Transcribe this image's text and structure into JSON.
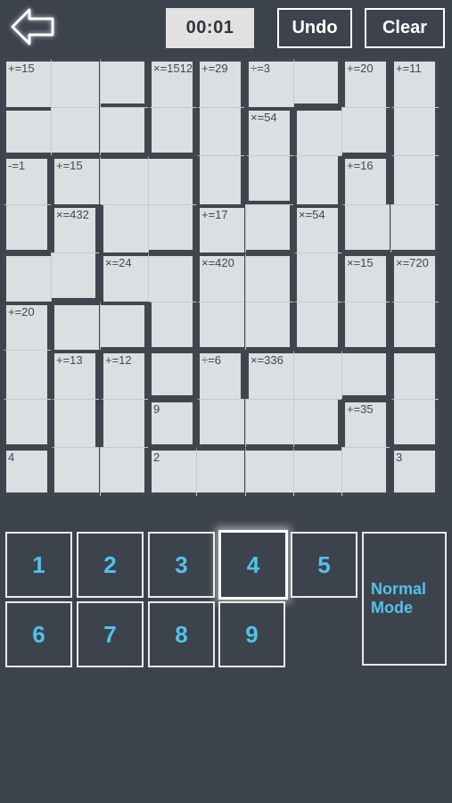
{
  "app": {
    "name": "kenken-puzzle",
    "background_color": "#3d434d",
    "accent_color": "#4fc3ec",
    "cell_color": "#dcdfe1",
    "cage_border_color": "#40454e"
  },
  "topbar": {
    "back_icon": "back-arrow-icon",
    "timer": "00:01",
    "undo_label": "Undo",
    "clear_label": "Clear"
  },
  "grid": {
    "size": 9,
    "cells": [
      {
        "r": 0,
        "c": 0,
        "label": "+=15",
        "value": "",
        "t": 1,
        "l": 1,
        "b": 0,
        "r_": 0
      },
      {
        "r": 0,
        "c": 1,
        "label": "",
        "value": "",
        "t": 1,
        "l": 0,
        "b": 0,
        "r_": 0
      },
      {
        "r": 0,
        "c": 2,
        "label": "",
        "value": "",
        "t": 1,
        "l": 0,
        "b": 1,
        "r_": 1
      },
      {
        "r": 0,
        "c": 3,
        "label": "×=1512",
        "value": "",
        "t": 1,
        "l": 1,
        "b": 0,
        "r_": 1
      },
      {
        "r": 0,
        "c": 4,
        "label": "+=29",
        "value": "",
        "t": 1,
        "l": 1,
        "b": 0,
        "r_": 1
      },
      {
        "r": 0,
        "c": 5,
        "label": "÷=3",
        "value": "",
        "t": 1,
        "l": 1,
        "b": 0,
        "r_": 0
      },
      {
        "r": 0,
        "c": 6,
        "label": "",
        "value": "",
        "t": 1,
        "l": 0,
        "b": 1,
        "r_": 1
      },
      {
        "r": 0,
        "c": 7,
        "label": "+=20",
        "value": "",
        "t": 1,
        "l": 1,
        "b": 0,
        "r_": 1
      },
      {
        "r": 0,
        "c": 8,
        "label": "+=11",
        "value": "",
        "t": 1,
        "l": 1,
        "b": 0,
        "r_": 1
      },
      {
        "r": 1,
        "c": 0,
        "label": "",
        "value": "",
        "t": 1,
        "l": 1,
        "b": 1,
        "r_": 0
      },
      {
        "r": 1,
        "c": 1,
        "label": "",
        "value": "",
        "t": 0,
        "l": 0,
        "b": 1,
        "r_": 0
      },
      {
        "r": 1,
        "c": 2,
        "label": "",
        "value": "",
        "t": 0,
        "l": 0,
        "b": 1,
        "r_": 1
      },
      {
        "r": 1,
        "c": 3,
        "label": "",
        "value": "",
        "t": 0,
        "l": 1,
        "b": 1,
        "r_": 1
      },
      {
        "r": 1,
        "c": 4,
        "label": "",
        "value": "",
        "t": 0,
        "l": 1,
        "b": 0,
        "r_": 1
      },
      {
        "r": 1,
        "c": 5,
        "label": "×=54",
        "value": "",
        "t": 1,
        "l": 1,
        "b": 0,
        "r_": 1
      },
      {
        "r": 1,
        "c": 6,
        "label": "",
        "value": "",
        "t": 1,
        "l": 1,
        "b": 0,
        "r_": 0
      },
      {
        "r": 1,
        "c": 7,
        "label": "",
        "value": "",
        "t": 0,
        "l": 0,
        "b": 1,
        "r_": 1
      },
      {
        "r": 1,
        "c": 8,
        "label": "",
        "value": "",
        "t": 0,
        "l": 1,
        "b": 0,
        "r_": 1
      },
      {
        "r": 2,
        "c": 0,
        "label": "-=1",
        "value": "",
        "t": 1,
        "l": 1,
        "b": 0,
        "r_": 1
      },
      {
        "r": 2,
        "c": 1,
        "label": "+=15",
        "value": "",
        "t": 1,
        "l": 1,
        "b": 0,
        "r_": 0
      },
      {
        "r": 2,
        "c": 2,
        "label": "",
        "value": "",
        "t": 1,
        "l": 0,
        "b": 0,
        "r_": 0
      },
      {
        "r": 2,
        "c": 3,
        "label": "",
        "value": "",
        "t": 1,
        "l": 0,
        "b": 0,
        "r_": 1
      },
      {
        "r": 2,
        "c": 4,
        "label": "",
        "value": "",
        "t": 0,
        "l": 1,
        "b": 0,
        "r_": 1
      },
      {
        "r": 2,
        "c": 5,
        "label": "",
        "value": "",
        "t": 0,
        "l": 1,
        "b": 1,
        "r_": 1
      },
      {
        "r": 2,
        "c": 6,
        "label": "",
        "value": "",
        "t": 0,
        "l": 1,
        "b": 0,
        "r_": 1
      },
      {
        "r": 2,
        "c": 7,
        "label": "+=16",
        "value": "",
        "t": 1,
        "l": 1,
        "b": 0,
        "r_": 1
      },
      {
        "r": 2,
        "c": 8,
        "label": "",
        "value": "",
        "t": 0,
        "l": 1,
        "b": 0,
        "r_": 1
      },
      {
        "r": 3,
        "c": 0,
        "label": "",
        "value": "",
        "t": 0,
        "l": 1,
        "b": 1,
        "r_": 1
      },
      {
        "r": 3,
        "c": 1,
        "label": "×=432",
        "value": "",
        "t": 1,
        "l": 1,
        "b": 0,
        "r_": 1
      },
      {
        "r": 3,
        "c": 2,
        "label": "",
        "value": "",
        "t": 0,
        "l": 1,
        "b": 0,
        "r_": 0
      },
      {
        "r": 3,
        "c": 3,
        "label": "",
        "value": "",
        "t": 0,
        "l": 0,
        "b": 1,
        "r_": 1
      },
      {
        "r": 3,
        "c": 4,
        "label": "+=17",
        "value": "",
        "t": 1,
        "l": 1,
        "b": 0,
        "r_": 0
      },
      {
        "r": 3,
        "c": 5,
        "label": "",
        "value": "",
        "t": 0,
        "l": 0,
        "b": 1,
        "r_": 1
      },
      {
        "r": 3,
        "c": 6,
        "label": "×=54",
        "value": "",
        "t": 1,
        "l": 1,
        "b": 0,
        "r_": 1
      },
      {
        "r": 3,
        "c": 7,
        "label": "",
        "value": "",
        "t": 0,
        "l": 1,
        "b": 1,
        "r_": 0
      },
      {
        "r": 3,
        "c": 8,
        "label": "",
        "value": "",
        "t": 0,
        "l": 0,
        "b": 1,
        "r_": 1
      },
      {
        "r": 4,
        "c": 0,
        "label": "",
        "value": "",
        "t": 1,
        "l": 1,
        "b": 0,
        "r_": 0
      },
      {
        "r": 4,
        "c": 1,
        "label": "",
        "value": "",
        "t": 0,
        "l": 0,
        "b": 1,
        "r_": 1
      },
      {
        "r": 4,
        "c": 2,
        "label": "×=24",
        "value": "",
        "t": 1,
        "l": 1,
        "b": 0,
        "r_": 0
      },
      {
        "r": 4,
        "c": 3,
        "label": "",
        "value": "",
        "t": 1,
        "l": 0,
        "b": 0,
        "r_": 1
      },
      {
        "r": 4,
        "c": 4,
        "label": "×=420",
        "value": "",
        "t": 1,
        "l": 1,
        "b": 0,
        "r_": 0
      },
      {
        "r": 4,
        "c": 5,
        "label": "",
        "value": "",
        "t": 1,
        "l": 0,
        "b": 0,
        "r_": 1
      },
      {
        "r": 4,
        "c": 6,
        "label": "",
        "value": "",
        "t": 0,
        "l": 1,
        "b": 0,
        "r_": 1
      },
      {
        "r": 4,
        "c": 7,
        "label": "×=15",
        "value": "",
        "t": 1,
        "l": 1,
        "b": 0,
        "r_": 1
      },
      {
        "r": 4,
        "c": 8,
        "label": "×=720",
        "value": "",
        "t": 1,
        "l": 1,
        "b": 0,
        "r_": 1
      },
      {
        "r": 5,
        "c": 0,
        "label": "+=20",
        "value": "",
        "t": 1,
        "l": 1,
        "b": 0,
        "r_": 1
      },
      {
        "r": 5,
        "c": 1,
        "label": "",
        "value": "",
        "t": 1,
        "l": 1,
        "b": 0,
        "r_": 0
      },
      {
        "r": 5,
        "c": 2,
        "label": "",
        "value": "",
        "t": 1,
        "l": 0,
        "b": 1,
        "r_": 1
      },
      {
        "r": 5,
        "c": 3,
        "label": "",
        "value": "",
        "t": 0,
        "l": 1,
        "b": 1,
        "r_": 1
      },
      {
        "r": 5,
        "c": 4,
        "label": "",
        "value": "",
        "t": 0,
        "l": 1,
        "b": 1,
        "r_": 0
      },
      {
        "r": 5,
        "c": 5,
        "label": "",
        "value": "",
        "t": 0,
        "l": 0,
        "b": 1,
        "r_": 1
      },
      {
        "r": 5,
        "c": 6,
        "label": "",
        "value": "",
        "t": 0,
        "l": 1,
        "b": 1,
        "r_": 1
      },
      {
        "r": 5,
        "c": 7,
        "label": "",
        "value": "",
        "t": 0,
        "l": 1,
        "b": 1,
        "r_": 1
      },
      {
        "r": 5,
        "c": 8,
        "label": "",
        "value": "",
        "t": 0,
        "l": 1,
        "b": 1,
        "r_": 1
      },
      {
        "r": 6,
        "c": 0,
        "label": "",
        "value": "",
        "t": 0,
        "l": 1,
        "b": 0,
        "r_": 1
      },
      {
        "r": 6,
        "c": 1,
        "label": "+=13",
        "value": "",
        "t": 1,
        "l": 1,
        "b": 0,
        "r_": 1
      },
      {
        "r": 6,
        "c": 2,
        "label": "+=12",
        "value": "",
        "t": 1,
        "l": 1,
        "b": 0,
        "r_": 1
      },
      {
        "r": 6,
        "c": 3,
        "label": "",
        "value": "",
        "t": 1,
        "l": 1,
        "b": 1,
        "r_": 1
      },
      {
        "r": 6,
        "c": 4,
        "label": "÷=6",
        "value": "",
        "t": 1,
        "l": 1,
        "b": 0,
        "r_": 1
      },
      {
        "r": 6,
        "c": 5,
        "label": "×=336",
        "value": "",
        "t": 1,
        "l": 1,
        "b": 0,
        "r_": 0
      },
      {
        "r": 6,
        "c": 6,
        "label": "",
        "value": "",
        "t": 1,
        "l": 0,
        "b": 0,
        "r_": 0
      },
      {
        "r": 6,
        "c": 7,
        "label": "",
        "value": "",
        "t": 1,
        "l": 0,
        "b": 1,
        "r_": 1
      },
      {
        "r": 6,
        "c": 8,
        "label": "",
        "value": "",
        "t": 1,
        "l": 1,
        "b": 0,
        "r_": 1
      },
      {
        "r": 7,
        "c": 0,
        "label": "",
        "value": "",
        "t": 0,
        "l": 1,
        "b": 1,
        "r_": 1
      },
      {
        "r": 7,
        "c": 1,
        "label": "",
        "value": "",
        "t": 0,
        "l": 1,
        "b": 0,
        "r_": 1
      },
      {
        "r": 7,
        "c": 2,
        "label": "",
        "value": "",
        "t": 0,
        "l": 1,
        "b": 0,
        "r_": 1
      },
      {
        "r": 7,
        "c": 3,
        "label": "9",
        "value": "",
        "t": 1,
        "l": 1,
        "b": 1,
        "r_": 1
      },
      {
        "r": 7,
        "c": 4,
        "label": "",
        "value": "",
        "t": 0,
        "l": 1,
        "b": 1,
        "r_": 0
      },
      {
        "r": 7,
        "c": 5,
        "label": "",
        "value": "",
        "t": 0,
        "l": 0,
        "b": 1,
        "r_": 0
      },
      {
        "r": 7,
        "c": 6,
        "label": "",
        "value": "",
        "t": 0,
        "l": 0,
        "b": 1,
        "r_": 1
      },
      {
        "r": 7,
        "c": 7,
        "label": "+=35",
        "value": "",
        "t": 1,
        "l": 1,
        "b": 0,
        "r_": 1
      },
      {
        "r": 7,
        "c": 8,
        "label": "",
        "value": "",
        "t": 0,
        "l": 1,
        "b": 1,
        "r_": 1
      },
      {
        "r": 8,
        "c": 0,
        "label": "4",
        "value": "",
        "t": 1,
        "l": 1,
        "b": 1,
        "r_": 1
      },
      {
        "r": 8,
        "c": 1,
        "label": "",
        "value": "",
        "t": 0,
        "l": 1,
        "b": 1,
        "r_": 0
      },
      {
        "r": 8,
        "c": 2,
        "label": "",
        "value": "",
        "t": 0,
        "l": 0,
        "b": 1,
        "r_": 1
      },
      {
        "r": 8,
        "c": 3,
        "label": "2",
        "value": "",
        "t": 1,
        "l": 1,
        "b": 1,
        "r_": 0
      },
      {
        "r": 8,
        "c": 4,
        "label": "",
        "value": "",
        "t": 1,
        "l": 0,
        "b": 1,
        "r_": 0
      },
      {
        "r": 8,
        "c": 5,
        "label": "",
        "value": "",
        "t": 1,
        "l": 0,
        "b": 1,
        "r_": 0
      },
      {
        "r": 8,
        "c": 6,
        "label": "",
        "value": "",
        "t": 1,
        "l": 0,
        "b": 1,
        "r_": 0
      },
      {
        "r": 8,
        "c": 7,
        "label": "",
        "value": "",
        "t": 0,
        "l": 0,
        "b": 1,
        "r_": 1
      },
      {
        "r": 8,
        "c": 8,
        "label": "3",
        "value": "",
        "t": 1,
        "l": 1,
        "b": 1,
        "r_": 1
      }
    ]
  },
  "keypad": {
    "keys": [
      {
        "label": "1",
        "selected": false
      },
      {
        "label": "2",
        "selected": false
      },
      {
        "label": "3",
        "selected": false
      },
      {
        "label": "4",
        "selected": true
      },
      {
        "label": "5",
        "selected": false
      },
      {
        "label": "6",
        "selected": false
      },
      {
        "label": "7",
        "selected": false
      },
      {
        "label": "8",
        "selected": false
      },
      {
        "label": "9",
        "selected": false
      }
    ],
    "mode_label": "Normal Mode",
    "mode_line1": "Normal",
    "mode_line2": "Mode"
  }
}
